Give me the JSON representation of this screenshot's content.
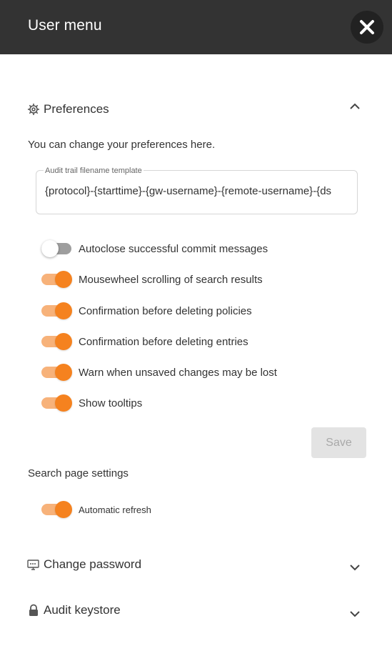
{
  "header": {
    "title": "User menu"
  },
  "preferences": {
    "title": "Preferences",
    "description": "You can change your preferences here.",
    "audit_field": {
      "label": "Audit trail filename template",
      "value": "{protocol}-{starttime}-{gw-username}-{remote-username}-{ds"
    },
    "toggles": [
      {
        "label": "Autoclose successful commit messages",
        "on": false
      },
      {
        "label": "Mousewheel scrolling of search results",
        "on": true
      },
      {
        "label": "Confirmation before deleting policies",
        "on": true
      },
      {
        "label": "Confirmation before deleting entries",
        "on": true
      },
      {
        "label": "Warn when unsaved changes may be lost",
        "on": true
      },
      {
        "label": "Show tooltips",
        "on": true
      }
    ],
    "save_label": "Save"
  },
  "search_settings": {
    "title": "Search page settings",
    "toggles": [
      {
        "label": "Automatic refresh",
        "on": true
      }
    ]
  },
  "change_password": {
    "title": "Change password"
  },
  "audit_keystore": {
    "title": "Audit keystore"
  },
  "colors": {
    "header_bg": "#333333",
    "accent": "#f5821f",
    "accent_light": "#f7b27a",
    "toggle_off_track": "#9e9e9e"
  },
  "icons": [
    "close-icon",
    "gear-icon",
    "chevron-up-icon",
    "monitor-key-icon",
    "lock-icon",
    "chevron-down-icon"
  ]
}
